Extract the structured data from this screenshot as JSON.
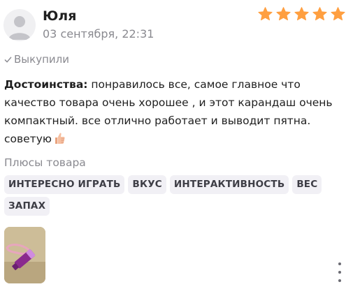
{
  "review": {
    "author": "Юля",
    "date": "03 сентября, 22:31",
    "rating": 5,
    "rating_max": 5,
    "star_color": "#ff9f40",
    "purchased_label": "Выкупили",
    "advantages_label": "Достоинства:",
    "advantages_text": " понравилось все, самое главное что качество товара очень хорошее , и этот карандаш очень компактный. все отлично работает и выводит пятна. советую",
    "emoji": "thumbs-up",
    "pros_title": "Плюсы товара",
    "tags": [
      "ИНТЕРЕСНО ИГРАТЬ",
      "ВКУС",
      "ИНТЕРАКТИВНОСТЬ",
      "ВЕС",
      "ЗАПАХ"
    ],
    "photo_count": 1,
    "menu_icon": "more-vertical-icon"
  }
}
